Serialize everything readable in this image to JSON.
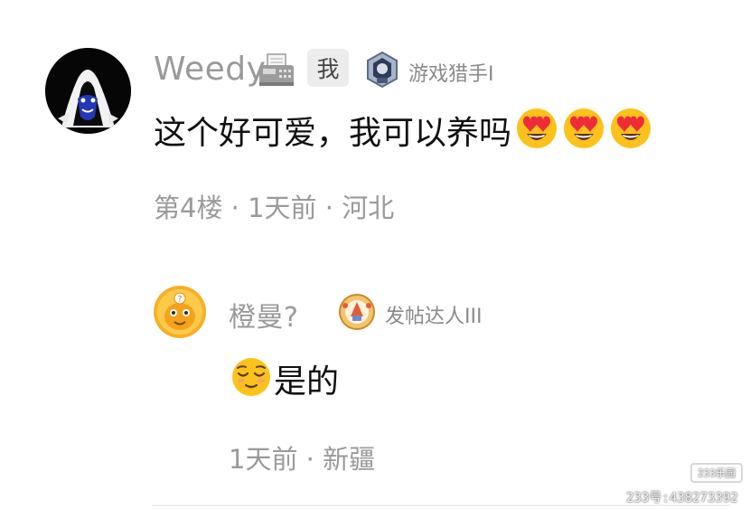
{
  "comment": {
    "username": "Weedy",
    "me_badge": "我",
    "title_badge": "游戏猎手I",
    "text": "这个好可爱，我可以养吗",
    "meta": "第4楼 · 1天前 · 河北"
  },
  "reply": {
    "username": "橙曼?",
    "title_badge": "发帖达人III",
    "text": "是的",
    "meta": "1天前 · 新疆"
  },
  "watermark": {
    "logo": "233乐园",
    "id_text": "233号:438273392"
  }
}
